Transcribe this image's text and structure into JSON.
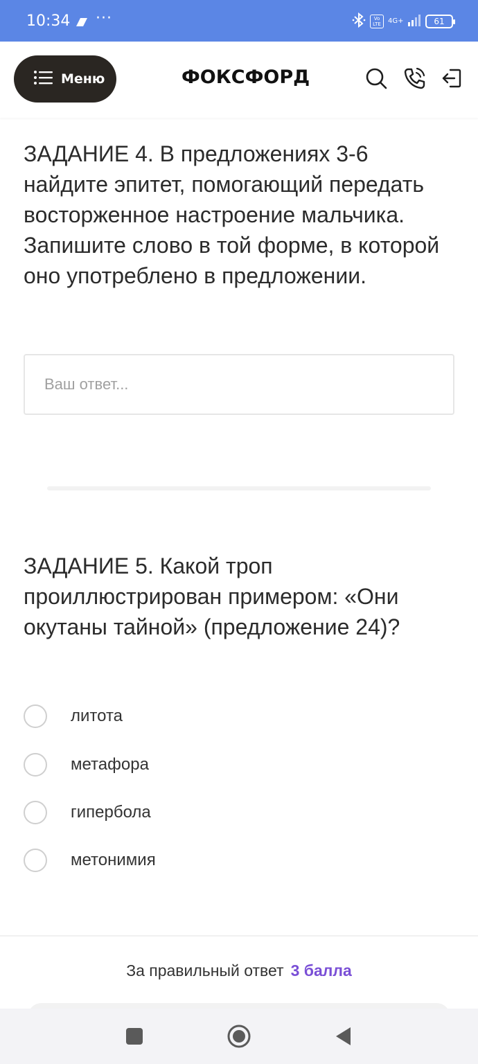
{
  "status_bar": {
    "time": "10:34",
    "dots": "···",
    "volte": "Vo LTE",
    "network": "4G+",
    "battery": "61"
  },
  "header": {
    "menu_label": "Меню",
    "logo": "ФОКСФОРД"
  },
  "task4": {
    "text": "ЗАДАНИЕ 4. В предложениях 3-6 найдите эпитет, помогающий передать восторженное настроение мальчика. Запишите слово в той форме, в которой оно употреблено в предложении.",
    "input_value": "",
    "input_placeholder": "Ваш ответ..."
  },
  "task5": {
    "text": "ЗАДАНИЕ 5. Какой троп проиллюстрирован примером: «Они окутаны тайной» (предложение 24)?",
    "options": [
      {
        "label": "литота"
      },
      {
        "label": "метафора"
      },
      {
        "label": "гипербола"
      },
      {
        "label": "метонимия"
      }
    ]
  },
  "footer": {
    "score_prefix": "За правильный ответ",
    "score_value": "3 балла"
  },
  "colors": {
    "status_bar": "#5b86e5",
    "menu_button": "#2a2622",
    "points_accent": "#7a4fd6"
  }
}
